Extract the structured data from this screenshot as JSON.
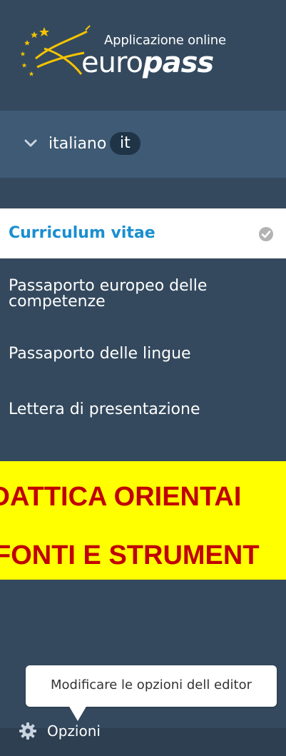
{
  "app": {
    "logo_tagline": "Applicazione online",
    "logo_word_thin": "euro",
    "logo_word_bold": "pass"
  },
  "language": {
    "label": "italiano",
    "code": "it"
  },
  "nav": {
    "items": [
      {
        "label": "Curriculum vitae",
        "active": true,
        "status_icon": "check-circle-icon"
      },
      {
        "label": "Passaporto europeo delle competenze",
        "line1": "Passaporto europeo delle",
        "line2": "competenze",
        "active": false
      },
      {
        "label": "Passaporto delle lingue",
        "active": false
      },
      {
        "label": "Lettera di presentazione",
        "active": false
      }
    ]
  },
  "banner": {
    "line1": "IDATTICA ORIENTAI",
    "line2": "FONTI E STRUMENT"
  },
  "tooltip": {
    "text": "Modificare le opzioni dell editor"
  },
  "options": {
    "label": "Opzioni",
    "icon": "gear-icon"
  },
  "colors": {
    "sidebar_bg": "#34495e",
    "lang_bar_bg": "#3e5a74",
    "lang_code_bg": "#1f3447",
    "active_text": "#1a8fd0",
    "banner_bg": "#ffff00",
    "banner_text": "#c00000"
  }
}
